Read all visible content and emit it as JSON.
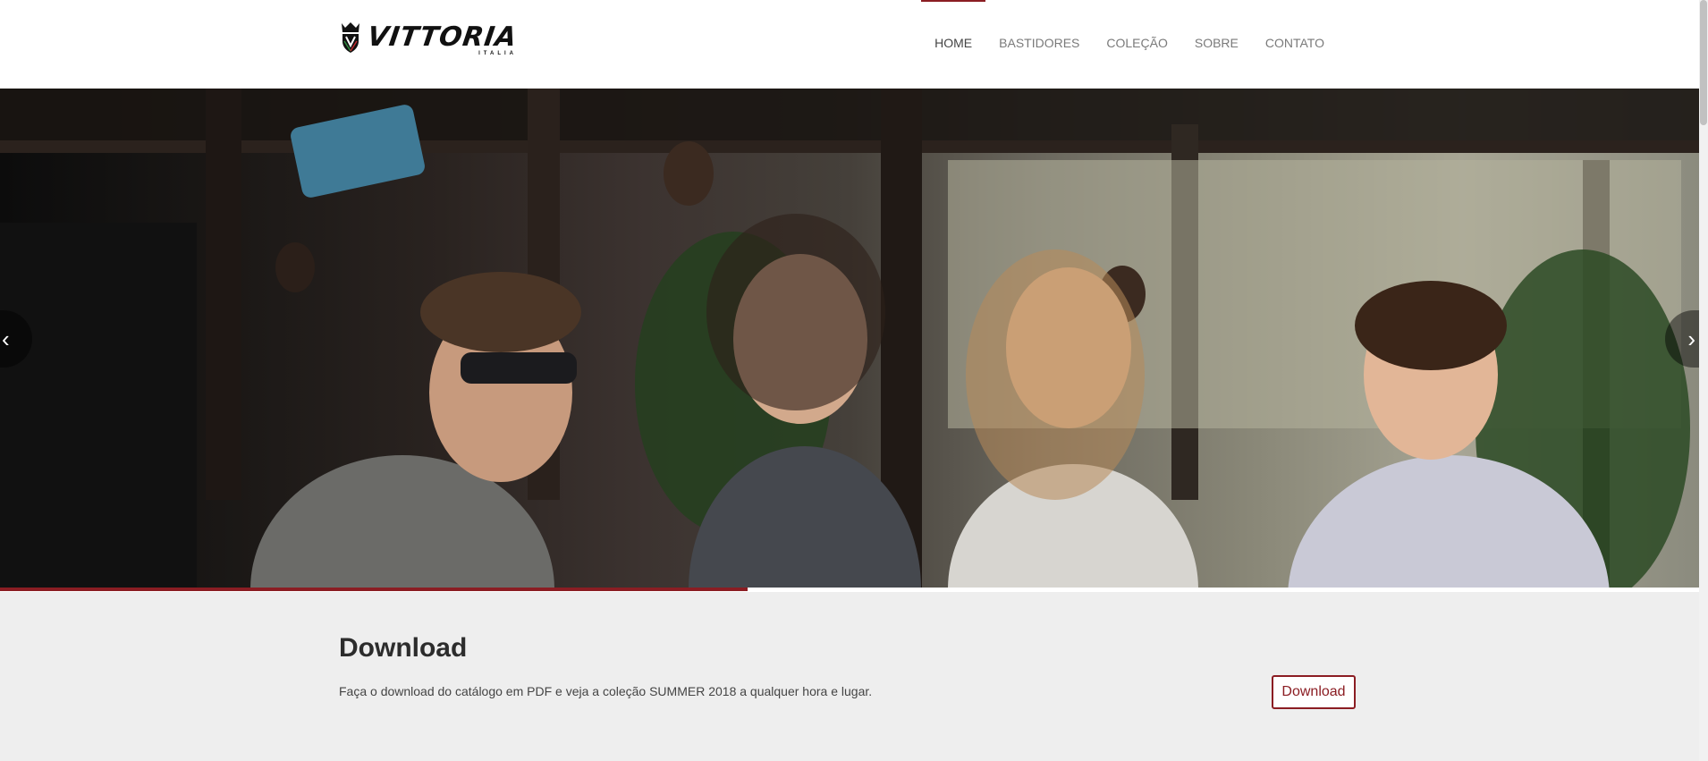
{
  "header": {
    "logo": {
      "text": "VITTORIA",
      "subtext": "ITALIA",
      "icon": "crest-icon"
    },
    "nav": [
      {
        "label": "HOME",
        "active": true
      },
      {
        "label": "BASTIDORES",
        "active": false
      },
      {
        "label": "COLEÇÃO",
        "active": false
      },
      {
        "label": "SOBRE",
        "active": false
      },
      {
        "label": "CONTATO",
        "active": false
      }
    ]
  },
  "slider": {
    "prev_arrow": "‹",
    "next_arrow": "›",
    "progress": 0.44
  },
  "download": {
    "title": "Download",
    "description": "Faça o download do catálogo em PDF e veja a coleção SUMMER 2018 a qualquer hora e lugar.",
    "button_label": "Download"
  },
  "colors": {
    "accent": "#8b1d23",
    "background": "#eeeeee",
    "header_bg": "#ffffff"
  }
}
